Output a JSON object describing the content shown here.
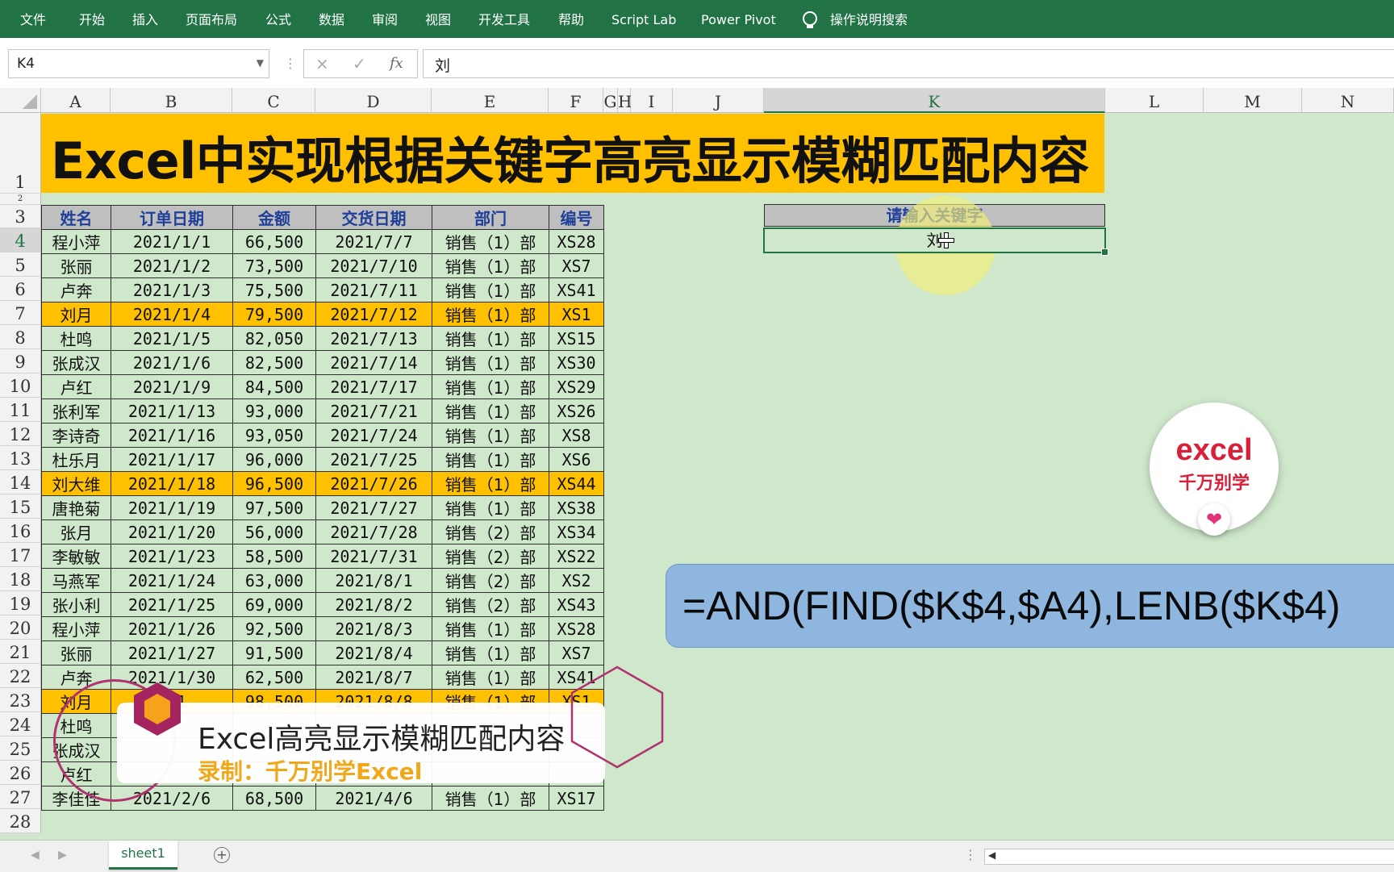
{
  "ribbon": {
    "tabs": [
      "文件",
      "开始",
      "插入",
      "页面布局",
      "公式",
      "数据",
      "审阅",
      "视图",
      "开发工具",
      "帮助",
      "Script Lab",
      "Power Pivot"
    ],
    "search": "操作说明搜索"
  },
  "formula_bar": {
    "name_box": "K4",
    "cancel_icon": "×",
    "enter_icon": "✓",
    "fx_label": "fx",
    "value": "刘"
  },
  "sheet": {
    "columns": [
      "A",
      "B",
      "C",
      "D",
      "E",
      "F",
      "G",
      "H",
      "I",
      "J",
      "K",
      "L",
      "M",
      "N"
    ],
    "rows": [
      "1",
      "2",
      "3",
      "4",
      "5",
      "6",
      "7",
      "8",
      "9",
      "10",
      "11",
      "12",
      "13",
      "14",
      "15",
      "16",
      "17",
      "18",
      "19",
      "20",
      "21",
      "22",
      "23",
      "24",
      "25",
      "26",
      "27",
      "28"
    ],
    "title": "Excel中实现根据关键字高亮显示模糊匹配内容",
    "table": {
      "headers": [
        "姓名",
        "订单日期",
        "金额",
        "交货日期",
        "部门",
        "编号"
      ],
      "rows": [
        {
          "cells": [
            "程小萍",
            "2021/1/1",
            "66,500",
            "2021/7/7",
            "销售（1）部",
            "XS28"
          ],
          "highlight": false
        },
        {
          "cells": [
            "张丽",
            "2021/1/2",
            "73,500",
            "2021/7/10",
            "销售（1）部",
            "XS7"
          ],
          "highlight": false
        },
        {
          "cells": [
            "卢奔",
            "2021/1/3",
            "75,500",
            "2021/7/11",
            "销售（1）部",
            "XS41"
          ],
          "highlight": false
        },
        {
          "cells": [
            "刘月",
            "2021/1/4",
            "79,500",
            "2021/7/12",
            "销售（1）部",
            "XS1"
          ],
          "highlight": true
        },
        {
          "cells": [
            "杜鸣",
            "2021/1/5",
            "82,050",
            "2021/7/13",
            "销售（1）部",
            "XS15"
          ],
          "highlight": false
        },
        {
          "cells": [
            "张成汉",
            "2021/1/6",
            "82,500",
            "2021/7/14",
            "销售（1）部",
            "XS30"
          ],
          "highlight": false
        },
        {
          "cells": [
            "卢红",
            "2021/1/9",
            "84,500",
            "2021/7/17",
            "销售（1）部",
            "XS29"
          ],
          "highlight": false
        },
        {
          "cells": [
            "张利军",
            "2021/1/13",
            "93,000",
            "2021/7/21",
            "销售（1）部",
            "XS26"
          ],
          "highlight": false
        },
        {
          "cells": [
            "李诗奇",
            "2021/1/16",
            "93,050",
            "2021/7/24",
            "销售（1）部",
            "XS8"
          ],
          "highlight": false
        },
        {
          "cells": [
            "杜乐月",
            "2021/1/17",
            "96,000",
            "2021/7/25",
            "销售（1）部",
            "XS6"
          ],
          "highlight": false
        },
        {
          "cells": [
            "刘大维",
            "2021/1/18",
            "96,500",
            "2021/7/26",
            "销售（1）部",
            "XS44"
          ],
          "highlight": true
        },
        {
          "cells": [
            "唐艳菊",
            "2021/1/19",
            "97,500",
            "2021/7/27",
            "销售（1）部",
            "XS38"
          ],
          "highlight": false
        },
        {
          "cells": [
            "张月",
            "2021/1/20",
            "56,000",
            "2021/7/28",
            "销售（2）部",
            "XS34"
          ],
          "highlight": false
        },
        {
          "cells": [
            "李敏敏",
            "2021/1/23",
            "58,500",
            "2021/7/31",
            "销售（2）部",
            "XS22"
          ],
          "highlight": false
        },
        {
          "cells": [
            "马燕军",
            "2021/1/24",
            "63,000",
            "2021/8/1",
            "销售（2）部",
            "XS2"
          ],
          "highlight": false
        },
        {
          "cells": [
            "张小利",
            "2021/1/25",
            "69,000",
            "2021/8/2",
            "销售（2）部",
            "XS43"
          ],
          "highlight": false
        },
        {
          "cells": [
            "程小萍",
            "2021/1/26",
            "92,500",
            "2021/8/3",
            "销售（1）部",
            "XS28"
          ],
          "highlight": false
        },
        {
          "cells": [
            "张丽",
            "2021/1/27",
            "91,500",
            "2021/8/4",
            "销售（1）部",
            "XS7"
          ],
          "highlight": false
        },
        {
          "cells": [
            "卢奔",
            "2021/1/30",
            "62,500",
            "2021/8/7",
            "销售（1）部",
            "XS41"
          ],
          "highlight": false
        },
        {
          "cells": [
            "刘月",
            "/31",
            "98,500",
            "2021/8/8",
            "销售（1）部",
            "XS1"
          ],
          "highlight": true
        },
        {
          "cells": [
            "杜鸣",
            "",
            "",
            "",
            "",
            ""
          ],
          "highlight": false
        },
        {
          "cells": [
            "张成汉",
            "",
            "",
            "",
            "",
            ""
          ],
          "highlight": false
        },
        {
          "cells": [
            "卢红",
            "",
            "",
            "",
            "",
            ""
          ],
          "highlight": false
        },
        {
          "cells": [
            "李佳佳",
            "2021/2/6",
            "68,500",
            "2021/4/6",
            "销售（1）部",
            "XS17"
          ],
          "highlight": false
        }
      ]
    },
    "keyword_header": "请输入关键字",
    "keyword_value": "刘"
  },
  "formula_display": "=AND(FIND($K$4,$A4),LENB($K$4)",
  "logo": {
    "line1": "excel",
    "line2": "千万别学",
    "heart": "❤"
  },
  "overlay": {
    "title": "Excel高亮显示模糊匹配内容",
    "subtitle": "录制：千万别学Excel"
  },
  "sheet_tabs": {
    "active": "sheet1",
    "add": "+"
  },
  "colors": {
    "ribbon": "#217346",
    "highlight": "#ffc000",
    "sheet_bg": "#cfe8cc",
    "header_text": "#1f3f9a"
  }
}
